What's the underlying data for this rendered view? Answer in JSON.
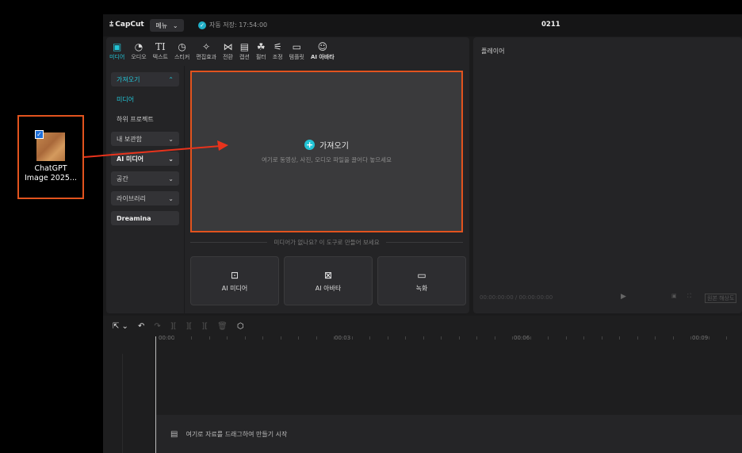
{
  "desktop": {
    "icon_label_1": "ChatGPT",
    "icon_label_2": "Image 2025..."
  },
  "app": {
    "logo": "CapCut",
    "menu_label": "메뉴",
    "autosave": "자동 저장: 17:54:00",
    "project_title": "0211"
  },
  "toolbar": [
    {
      "label": "미디어",
      "icon": "media-icon"
    },
    {
      "label": "오디오",
      "icon": "audio-icon"
    },
    {
      "label": "텍스트",
      "icon": "text-icon"
    },
    {
      "label": "스티커",
      "icon": "sticker-icon"
    },
    {
      "label": "편집효과",
      "icon": "effects-icon"
    },
    {
      "label": "전환",
      "icon": "transition-icon"
    },
    {
      "label": "캡션",
      "icon": "caption-icon"
    },
    {
      "label": "필터",
      "icon": "filter-icon"
    },
    {
      "label": "조정",
      "icon": "adjust-icon"
    },
    {
      "label": "템플릿",
      "icon": "template-icon"
    },
    {
      "label": "AI 아바타",
      "icon": "ai-avatar-icon"
    }
  ],
  "sidebar": {
    "import": "가져오기",
    "media": "미디어",
    "subprojects": "하위 프로젝트",
    "my_storage": "내 보관함",
    "ai_media": "AI 미디어",
    "space": "공간",
    "library": "라이브러리",
    "dreamina": "Dreamina"
  },
  "dropzone": {
    "title": "가져오기",
    "subtitle": "여기로 동영상, 사진, 오디오 파일을 끌어다 놓으세요"
  },
  "tools_separator": "미디어가 없나요? 이 도구로 만들어 보세요",
  "cards": [
    {
      "label": "AI 미디어"
    },
    {
      "label": "AI 아바타"
    },
    {
      "label": "녹화"
    }
  ],
  "player": {
    "label": "플레이어",
    "timecode": "00:00:00:00 / 00:00:00:00",
    "ratio": "원본 해상도"
  },
  "timeline": {
    "ticks": [
      "00:00",
      "00:03",
      "00:06",
      "00:09"
    ],
    "drop_hint": "여기로 자료를 드래그하여 만들기 시작"
  }
}
